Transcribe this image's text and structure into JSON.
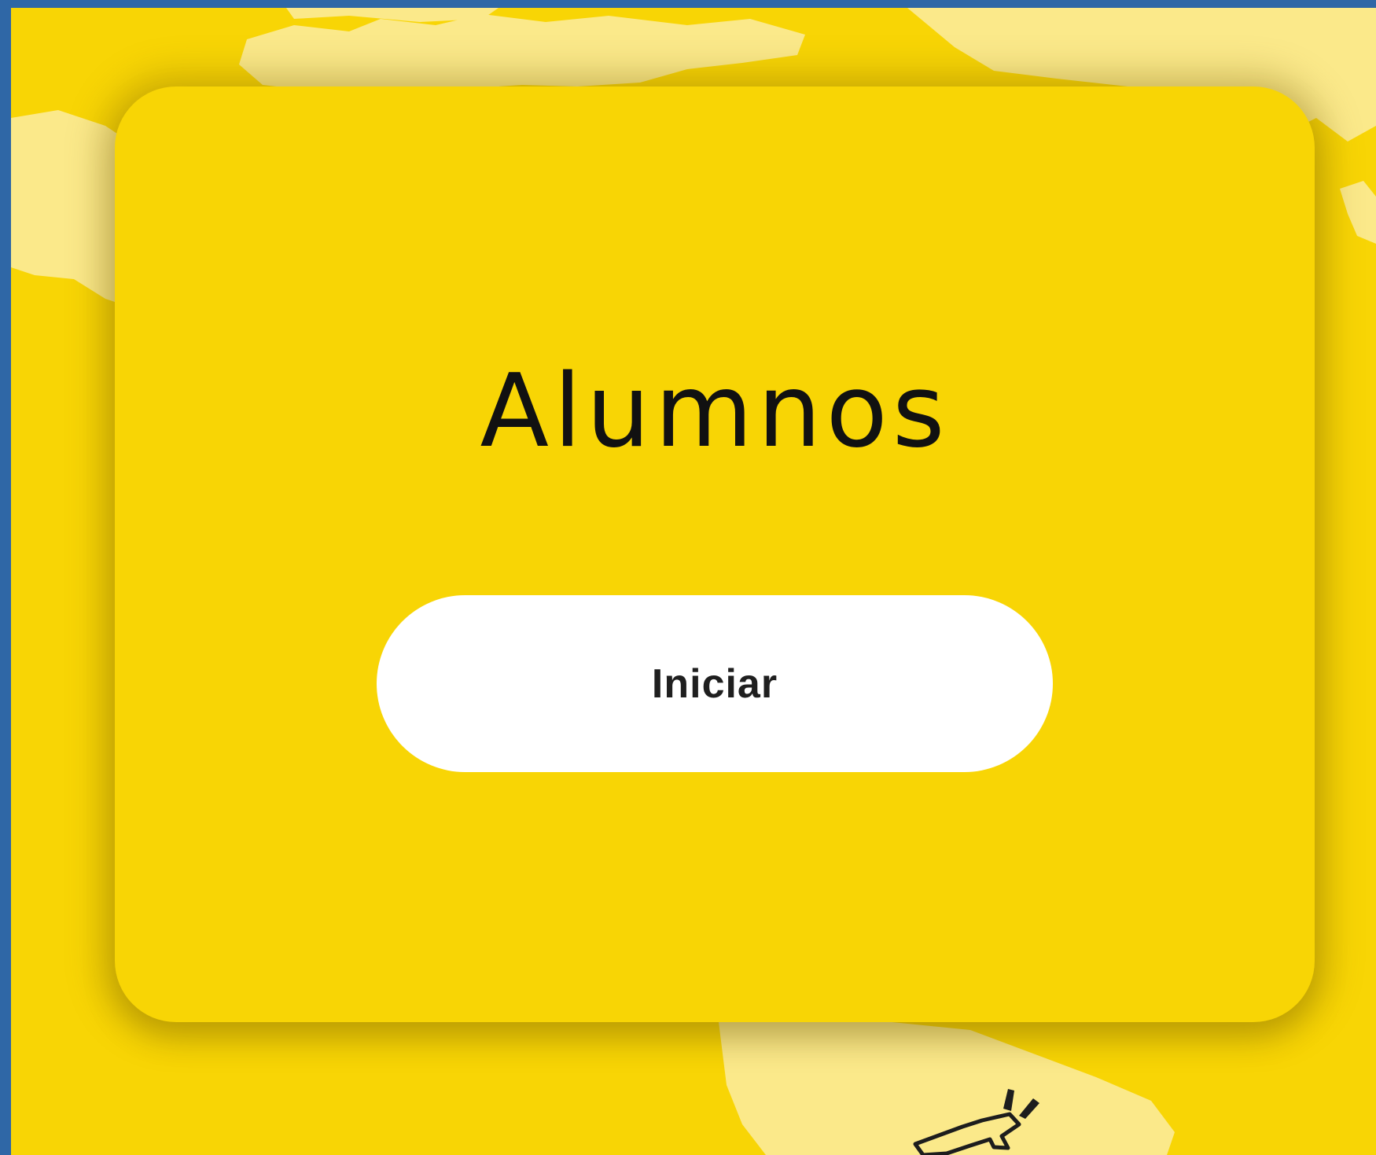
{
  "card": {
    "title": "Alumnos",
    "start_label": "Iniciar"
  },
  "background": {
    "description_icon": "world-map-decoration",
    "decoration_icon": "airplane-icon"
  },
  "colors": {
    "page_border": "#2f67a6",
    "background_yellow": "#f8d505",
    "map_land": "#fbe98a",
    "button_bg": "#ffffff",
    "text_dark": "#111111"
  }
}
